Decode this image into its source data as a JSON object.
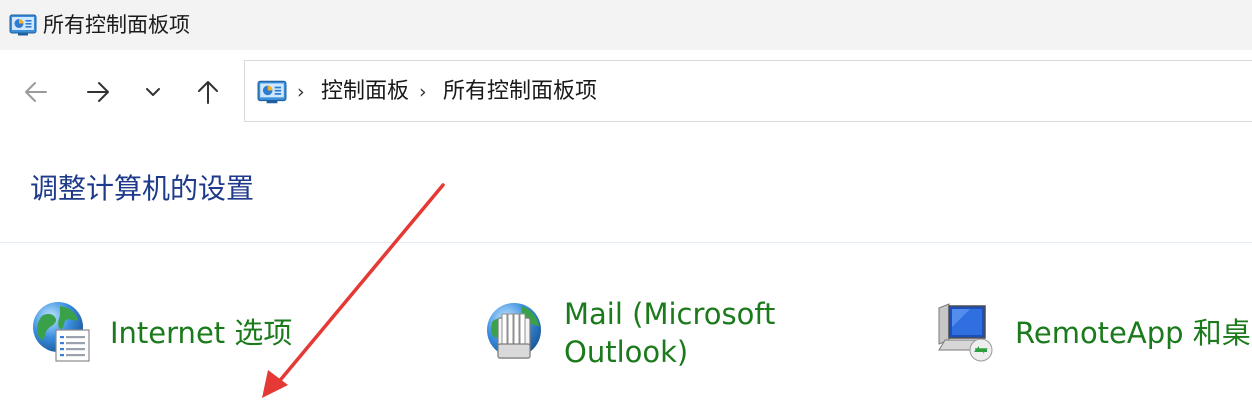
{
  "window": {
    "title": "所有控制面板项"
  },
  "nav": {
    "back_icon": "arrow-left-icon",
    "forward_icon": "arrow-right-icon",
    "recent_icon": "chevron-down-icon",
    "up_icon": "arrow-up-icon"
  },
  "address": {
    "breadcrumbs": [
      {
        "label": "控制面板"
      },
      {
        "label": "所有控制面板项"
      }
    ],
    "separator": "›"
  },
  "content": {
    "heading": "调整计算机的设置",
    "items": [
      {
        "label": "Internet 选项",
        "icon": "internet-options-icon"
      },
      {
        "label": "Mail (Microsoft\nOutlook)",
        "icon": "mail-icon"
      },
      {
        "label": "RemoteApp 和桌面",
        "icon": "remoteapp-icon"
      }
    ]
  },
  "colors": {
    "heading": "#1e3a8a",
    "item_link": "#1b7a1b",
    "annotation_arrow": "#e53935",
    "titlebar_bg": "#f3f3f3"
  }
}
